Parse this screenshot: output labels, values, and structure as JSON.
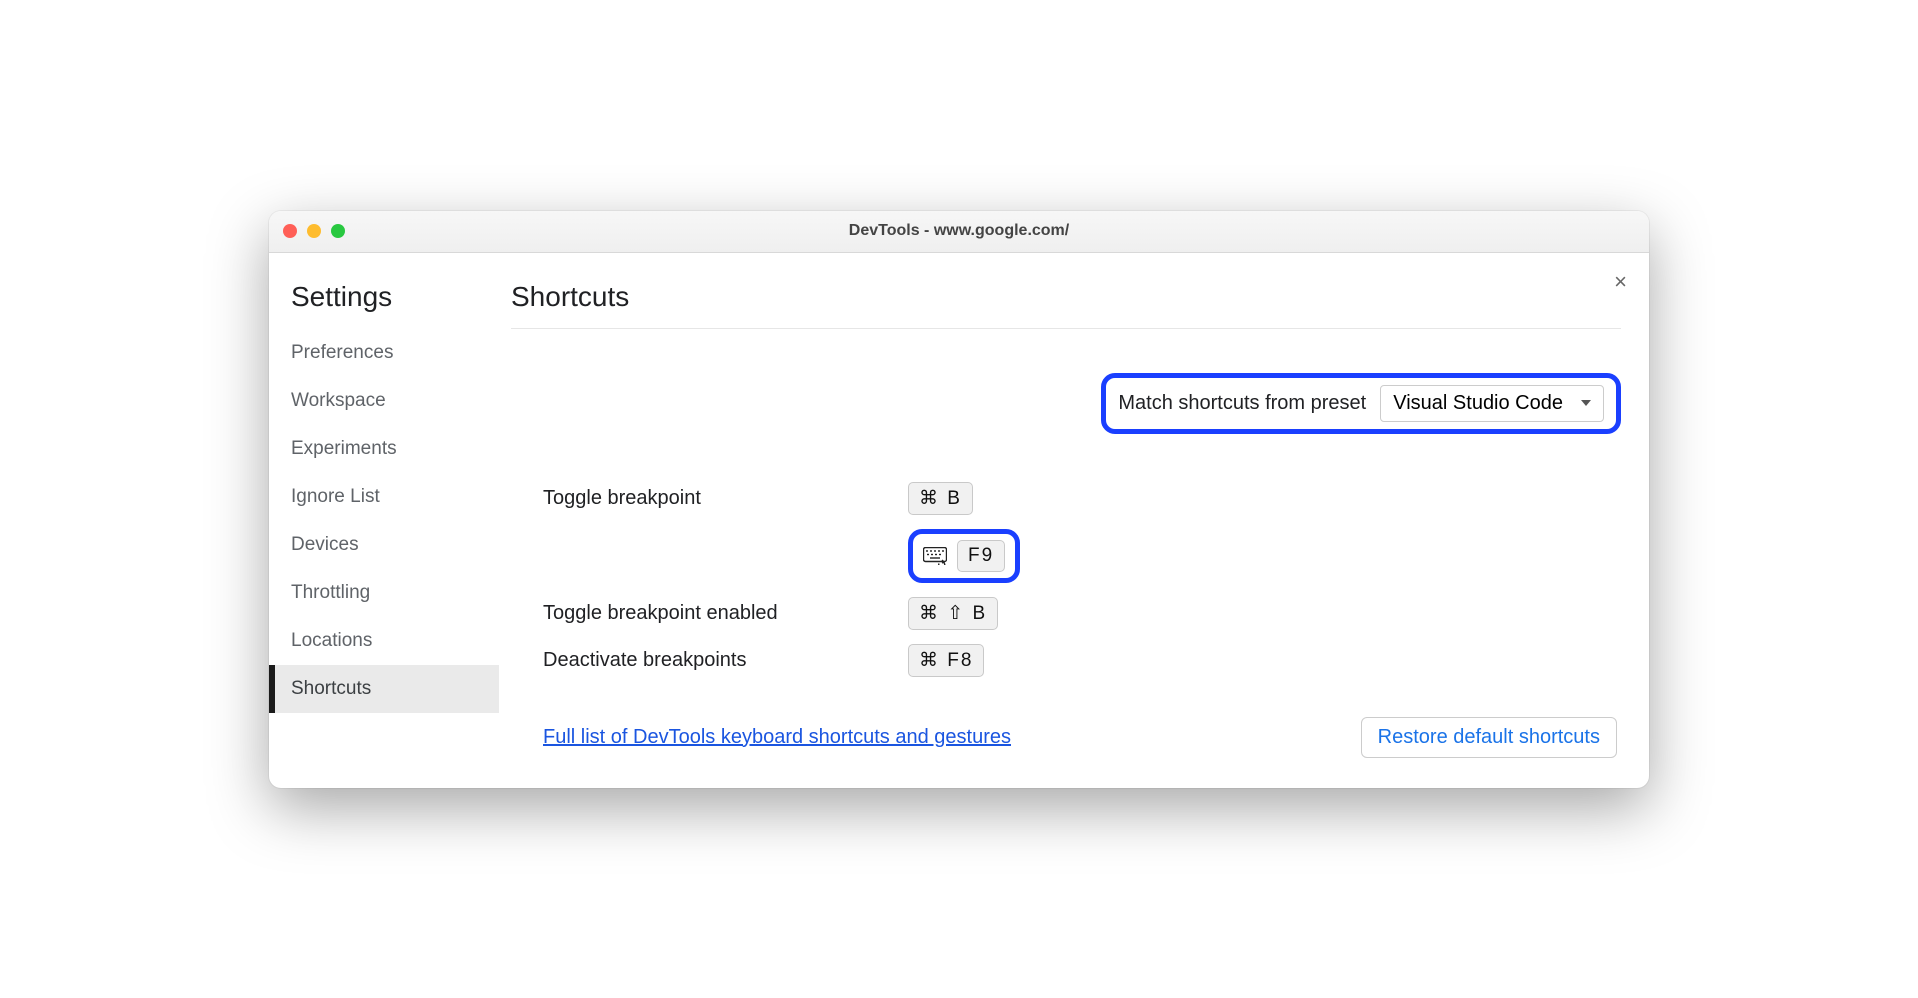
{
  "window": {
    "title": "DevTools - www.google.com/"
  },
  "sidebar": {
    "heading": "Settings",
    "items": [
      {
        "label": "Preferences",
        "active": false
      },
      {
        "label": "Workspace",
        "active": false
      },
      {
        "label": "Experiments",
        "active": false
      },
      {
        "label": "Ignore List",
        "active": false
      },
      {
        "label": "Devices",
        "active": false
      },
      {
        "label": "Throttling",
        "active": false
      },
      {
        "label": "Locations",
        "active": false
      },
      {
        "label": "Shortcuts",
        "active": true
      }
    ]
  },
  "main": {
    "title": "Shortcuts",
    "preset": {
      "label": "Match shortcuts from preset",
      "selected": "Visual Studio Code"
    },
    "shortcuts": [
      {
        "label": "Toggle breakpoint",
        "keys": "⌘ B"
      },
      {
        "label": "",
        "keys": "F9",
        "has_icon": true,
        "highlighted": true
      },
      {
        "label": "Toggle breakpoint enabled",
        "keys": "⌘ ⇧ B"
      },
      {
        "label": "Deactivate breakpoints",
        "keys": "⌘ F8"
      }
    ],
    "link_text": "Full list of DevTools keyboard shortcuts and gestures",
    "restore_button": "Restore default shortcuts"
  },
  "highlight_color": "#1a3fff"
}
